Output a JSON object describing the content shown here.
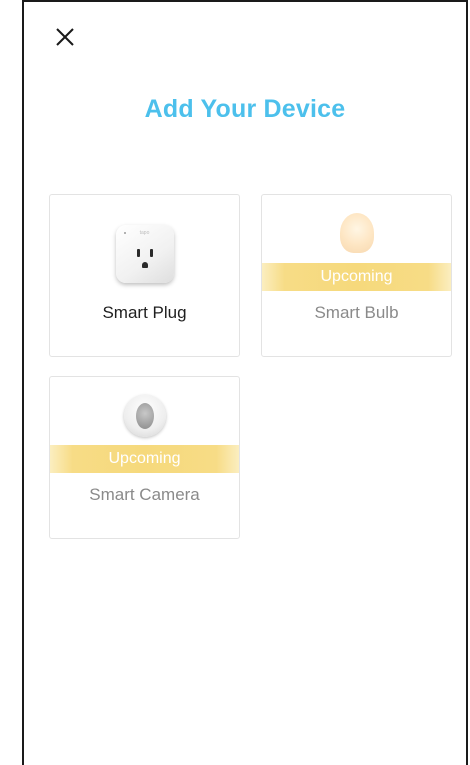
{
  "header": {
    "close_icon": "close-icon",
    "title": "Add Your Device"
  },
  "devices": [
    {
      "label": "Smart Plug",
      "status": "",
      "icon": "smart-plug-icon",
      "brand_text": "tapo"
    },
    {
      "label": "Smart Bulb",
      "status": "Upcoming",
      "icon": "smart-bulb-icon"
    },
    {
      "label": "Smart Camera",
      "status": "Upcoming",
      "icon": "smart-camera-icon"
    }
  ],
  "colors": {
    "title": "#4cc0ec",
    "upcoming_badge": "#f6d97c",
    "card_border": "#e3e3e3"
  }
}
